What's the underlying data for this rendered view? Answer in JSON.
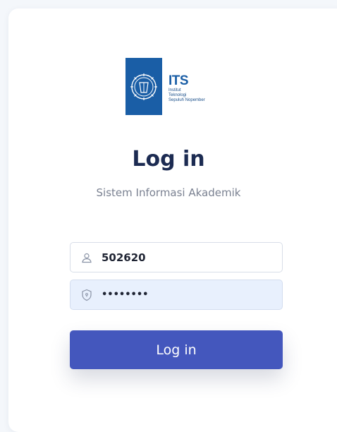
{
  "logo": {
    "abbr": "ITS",
    "line1": "Institut",
    "line2": "Teknologi",
    "line3": "Sepuluh Nopember"
  },
  "header": {
    "title": "Log in",
    "subtitle": "Sistem Informasi Akademik"
  },
  "form": {
    "username": {
      "value": "502620",
      "icon": "user-icon"
    },
    "password": {
      "value": "secret12",
      "icon": "shield-icon"
    },
    "submit_label": "Log in"
  },
  "colors": {
    "brand_blue": "#1a5ea6",
    "button": "#4457bd",
    "title": "#1c2b52"
  }
}
